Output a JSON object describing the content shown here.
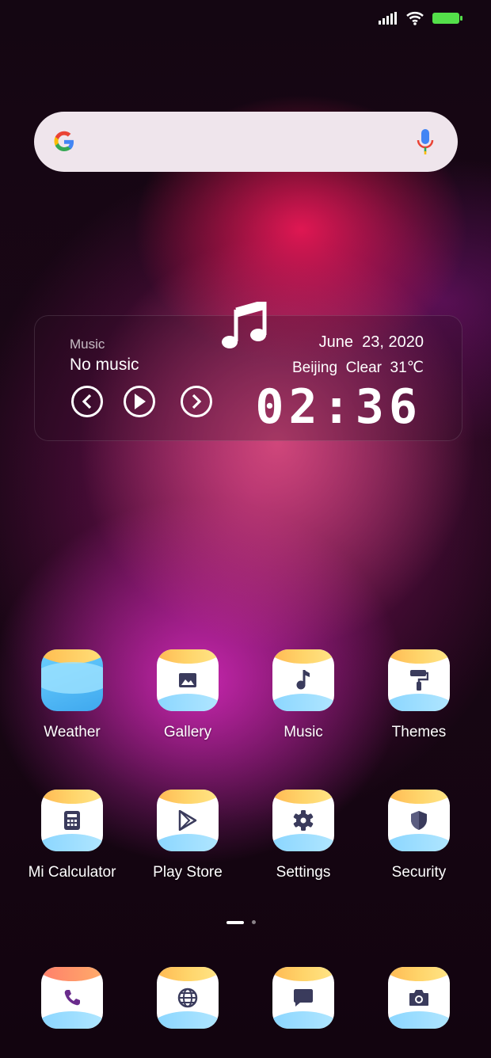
{
  "widget": {
    "music_label": "Music",
    "track": "No music",
    "date": "June  23, 2020",
    "weather": "Beijing  Clear  31℃",
    "time": "02:36"
  },
  "apps_row1": [
    {
      "label": "Weather",
      "icon": "weather-icon"
    },
    {
      "label": "Gallery",
      "icon": "gallery-icon"
    },
    {
      "label": "Music",
      "icon": "music-note-icon"
    },
    {
      "label": "Themes",
      "icon": "paint-roller-icon"
    }
  ],
  "apps_row2": [
    {
      "label": "Mi Calculator",
      "icon": "calculator-icon"
    },
    {
      "label": "Play Store",
      "icon": "play-store-icon"
    },
    {
      "label": "Settings",
      "icon": "gear-icon"
    },
    {
      "label": "Security",
      "icon": "shield-icon"
    }
  ],
  "dock": [
    {
      "icon": "phone-icon"
    },
    {
      "icon": "browser-globe-icon"
    },
    {
      "icon": "messages-icon"
    },
    {
      "icon": "camera-icon"
    }
  ],
  "pager": {
    "pages": 2,
    "current": 1
  },
  "colors": {
    "battery": "#54e04a",
    "glyph": "#3a3b5c"
  }
}
